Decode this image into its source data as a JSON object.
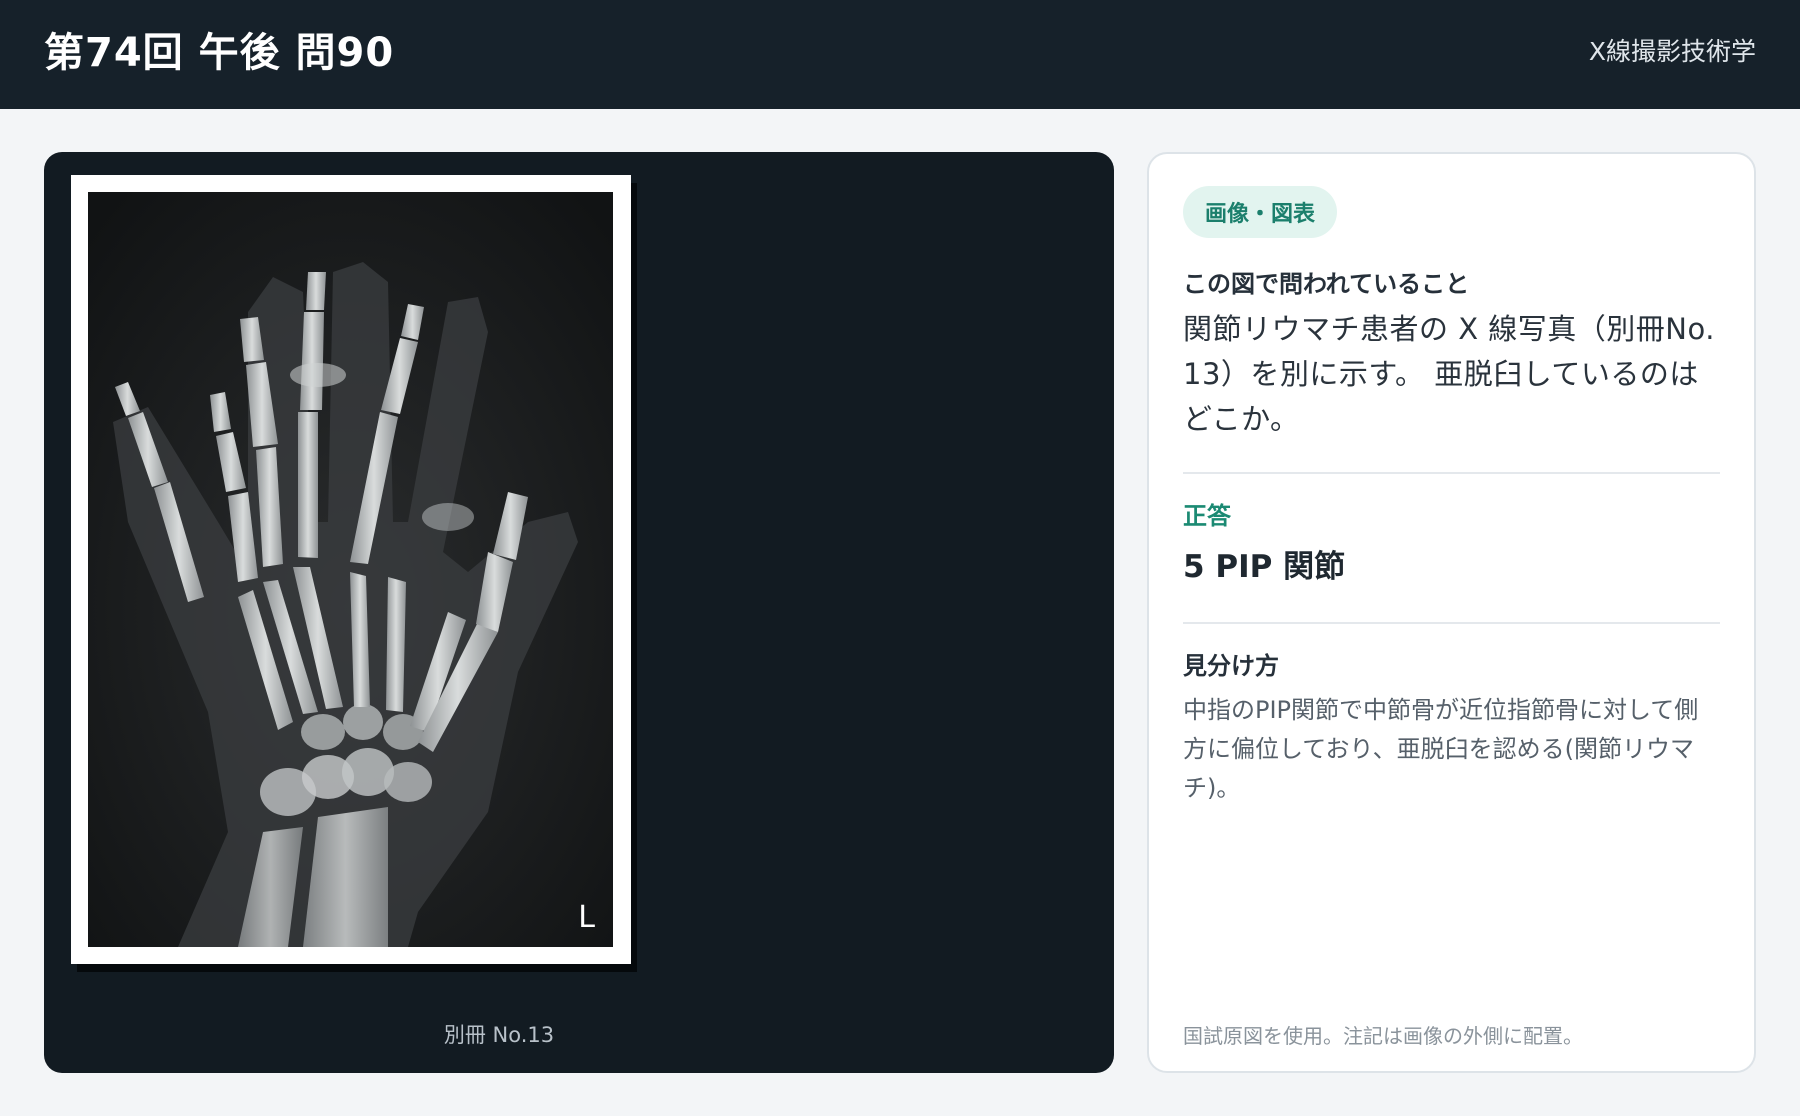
{
  "header": {
    "title": "第74回 午後 問90",
    "subject": "X線撮影技術学"
  },
  "viewer": {
    "image_alt": "手の X 線写真",
    "side_marker": "L",
    "caption": "別冊 No.13"
  },
  "panel": {
    "tag": "画像・図表",
    "question_label": "この図で問われていること",
    "question_text": "関節リウマチ患者の X 線写真（別冊No. 13）を別に示す。 亜脱臼しているのはどこか。",
    "answer_label": "正答",
    "answer_text": "5 PIP 関節",
    "how_label": "見分け方",
    "explanation": "中指のPIP関節で中節骨が近位指節骨に対して側方に偏位しており、亜脱臼を認める(関節リウマチ)。",
    "note": "国試原図を使用。注記は画像の外側に配置。"
  },
  "colors": {
    "header_bg": "#16212a",
    "viewer_bg": "#121b22",
    "accent": "#1b8a73",
    "tag_bg": "#e2f4ef"
  }
}
